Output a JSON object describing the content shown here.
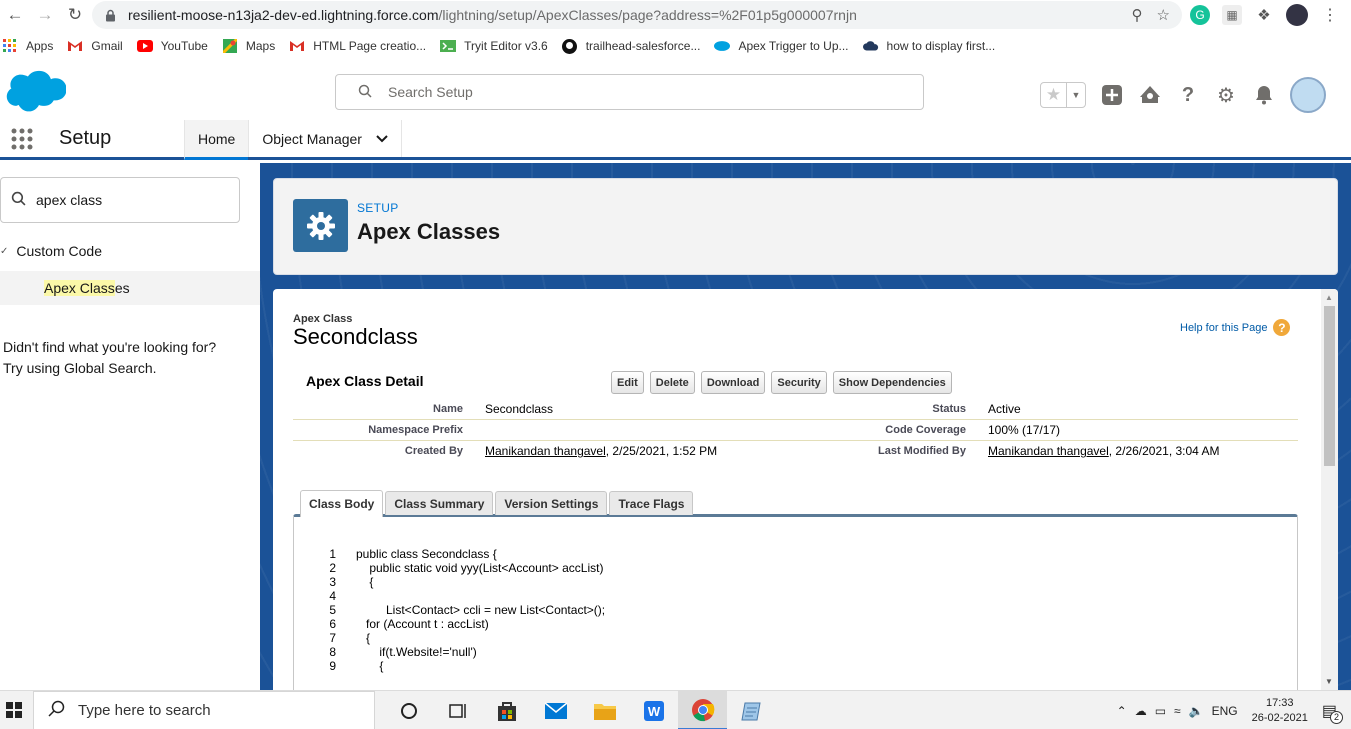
{
  "browser": {
    "url_host": "resilient-moose-n13ja2-dev-ed.lightning.force.com",
    "url_path": "/lightning/setup/ApexClasses/page?address=%2F01p5g000007rnjn",
    "bookmarks": [
      {
        "label": "Apps",
        "icon": "apps-grid-icon",
        "color": "#e94235"
      },
      {
        "label": "Gmail",
        "icon": "gmail-icon",
        "color": "#d93025"
      },
      {
        "label": "YouTube",
        "icon": "youtube-icon",
        "color": "#ff0000"
      },
      {
        "label": "Maps",
        "icon": "maps-icon",
        "color": "#34a853"
      },
      {
        "label": "HTML Page creatio...",
        "icon": "gmail-icon",
        "color": "#d93025"
      },
      {
        "label": "Tryit Editor v3.6",
        "icon": "w3schools-icon",
        "color": "#4caf50"
      },
      {
        "label": "trailhead-salesforce...",
        "icon": "github-icon",
        "color": "#111111"
      },
      {
        "label": "Apex Trigger to Up...",
        "icon": "salesforce-cloud-icon",
        "color": "#00a1e0"
      },
      {
        "label": "how to display first...",
        "icon": "cloud-icon",
        "color": "#23395d"
      }
    ]
  },
  "header": {
    "search_placeholder": "Search Setup"
  },
  "nav": {
    "app_name": "Setup",
    "tabs": [
      {
        "label": "Home",
        "active": true
      },
      {
        "label": "Object Manager",
        "active": false
      }
    ]
  },
  "sidebar": {
    "quickfind_value": "apex class",
    "section_label": "Custom Code",
    "item_highlight": "Apex Class",
    "item_rest": "es",
    "notfound_line1": "Didn't find what you're looking for?",
    "notfound_line2": "Try using Global Search."
  },
  "page_header": {
    "eyebrow": "SETUP",
    "title": "Apex Classes"
  },
  "detail": {
    "object_label": "Apex Class",
    "record_name": "Secondclass",
    "help_link": "Help for this Page",
    "section_title": "Apex Class Detail",
    "buttons": [
      "Edit",
      "Delete",
      "Download",
      "Security",
      "Show Dependencies"
    ],
    "fields": {
      "name_label": "Name",
      "name_value": "Secondclass",
      "status_label": "Status",
      "status_value": "Active",
      "ns_label": "Namespace Prefix",
      "ns_value": "",
      "coverage_label": "Code Coverage",
      "coverage_value": "100% (17/17)",
      "created_label": "Created By",
      "created_user": "Manikandan thangavel",
      "created_date": ", 2/25/2021, 1:52 PM",
      "modified_label": "Last Modified By",
      "modified_user": "Manikandan thangavel",
      "modified_date": ", 2/26/2021, 3:04 AM"
    },
    "tabs": [
      {
        "label": "Class Body",
        "active": true
      },
      {
        "label": "Class Summary",
        "active": false
      },
      {
        "label": "Version Settings",
        "active": false
      },
      {
        "label": "Trace Flags",
        "active": false
      }
    ],
    "code_lines": [
      {
        "n": "1",
        "text": "public class Secondclass {"
      },
      {
        "n": "2",
        "text": "    public static void yyy(List<Account> accList)"
      },
      {
        "n": "3",
        "text": "    {"
      },
      {
        "n": "4",
        "text": ""
      },
      {
        "n": "5",
        "text": "         List<Contact> ccli = new List<Contact>();"
      },
      {
        "n": "6",
        "text": "   for (Account t : accList)"
      },
      {
        "n": "7",
        "text": "   {"
      },
      {
        "n": "8",
        "text": "       if(t.Website!='null')"
      },
      {
        "n": "9",
        "text": "       {"
      }
    ]
  },
  "taskbar": {
    "search_placeholder": "Type here to search",
    "lang": "ENG",
    "time": "17:33",
    "date": "26-02-2021",
    "notif_count": "2"
  }
}
